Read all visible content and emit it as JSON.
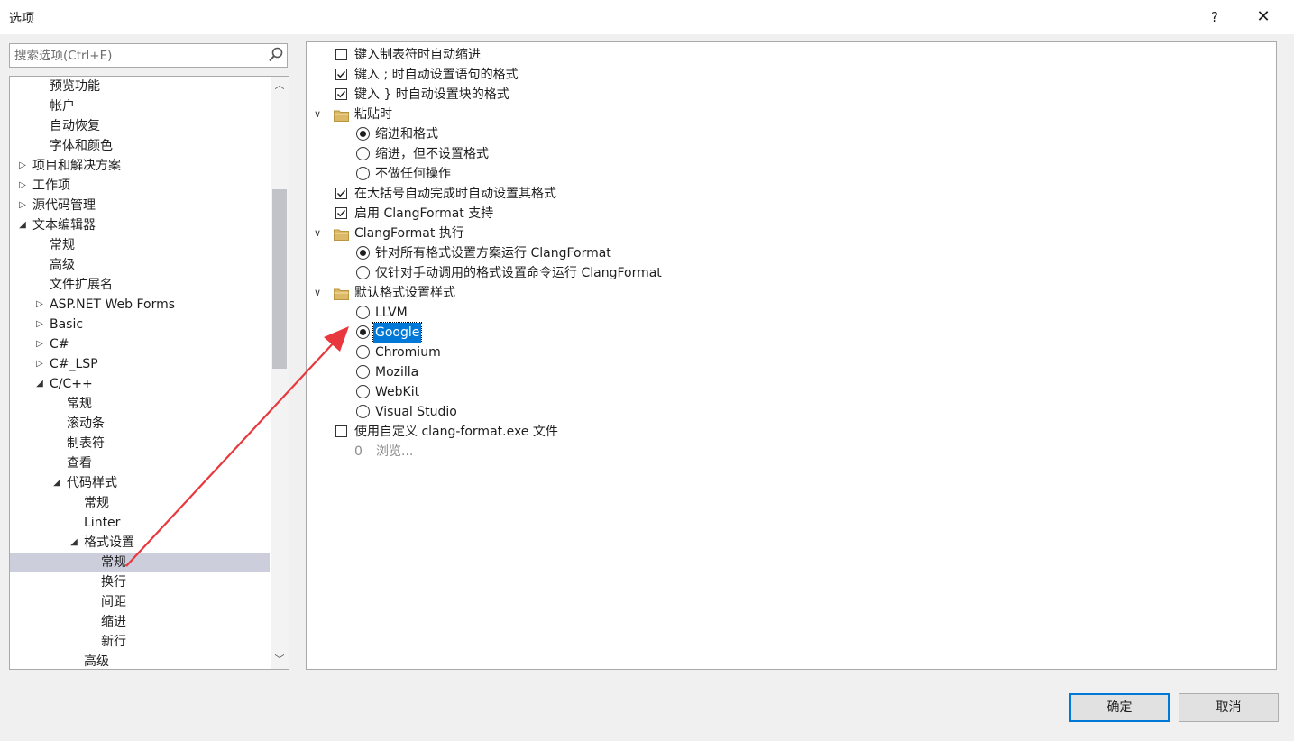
{
  "window": {
    "title": "选项",
    "help_label": "?",
    "close_label": "✕"
  },
  "search": {
    "placeholder": "搜索选项(Ctrl+E)",
    "value": ""
  },
  "tree": {
    "items": [
      {
        "label": "预览功能",
        "arrow": ""
      },
      {
        "label": "帐户",
        "arrow": ""
      },
      {
        "label": "自动恢复",
        "arrow": ""
      },
      {
        "label": "字体和颜色",
        "arrow": ""
      },
      {
        "label": "项目和解决方案",
        "arrow": "▷"
      },
      {
        "label": "工作项",
        "arrow": "▷"
      },
      {
        "label": "源代码管理",
        "arrow": "▷"
      },
      {
        "label": "文本编辑器",
        "arrow": "◢"
      },
      {
        "label": "常规",
        "arrow": ""
      },
      {
        "label": "高级",
        "arrow": ""
      },
      {
        "label": "文件扩展名",
        "arrow": ""
      },
      {
        "label": "ASP.NET Web Forms",
        "arrow": "▷"
      },
      {
        "label": "Basic",
        "arrow": "▷"
      },
      {
        "label": "C#",
        "arrow": "▷"
      },
      {
        "label": "C#_LSP",
        "arrow": "▷"
      },
      {
        "label": "C/C++",
        "arrow": "◢"
      },
      {
        "label": "常规",
        "arrow": ""
      },
      {
        "label": "滚动条",
        "arrow": ""
      },
      {
        "label": "制表符",
        "arrow": ""
      },
      {
        "label": "查看",
        "arrow": ""
      },
      {
        "label": "代码样式",
        "arrow": "◢"
      },
      {
        "label": "常规",
        "arrow": ""
      },
      {
        "label": "Linter",
        "arrow": ""
      },
      {
        "label": "格式设置",
        "arrow": "◢"
      },
      {
        "label": "常规",
        "arrow": "",
        "selected": true
      },
      {
        "label": "换行",
        "arrow": ""
      },
      {
        "label": "间距",
        "arrow": ""
      },
      {
        "label": "缩进",
        "arrow": ""
      },
      {
        "label": "新行",
        "arrow": ""
      },
      {
        "label": "高级",
        "arrow": ""
      }
    ]
  },
  "options": {
    "auto_indent_tab": {
      "label": "键入制表符时自动缩进",
      "checked": false
    },
    "format_on_semicolon": {
      "label": "键入 ; 时自动设置语句的格式",
      "checked": true
    },
    "format_on_brace": {
      "label": "键入 } 时自动设置块的格式",
      "checked": true
    },
    "paste_group": {
      "label": "粘贴时",
      "choices": [
        "缩进和格式",
        "缩进，但不设置格式",
        "不做任何操作"
      ],
      "selected": "缩进和格式"
    },
    "format_on_brace_complete": {
      "label": "在大括号自动完成时自动设置其格式",
      "checked": true
    },
    "enable_clangformat": {
      "label": "启用 ClangFormat 支持",
      "checked": true
    },
    "clangformat_exec_group": {
      "label": "ClangFormat 执行",
      "choices": [
        "针对所有格式设置方案运行 ClangFormat",
        "仅针对手动调用的格式设置命令运行 ClangFormat"
      ],
      "selected": "针对所有格式设置方案运行 ClangFormat"
    },
    "default_style_group": {
      "label": "默认格式设置样式",
      "choices": [
        "LLVM",
        "Google",
        "Chromium",
        "Mozilla",
        "WebKit",
        "Visual Studio"
      ],
      "selected": "Google"
    },
    "custom_clang_format": {
      "label": "使用自定义 clang-format.exe 文件",
      "checked": false
    },
    "browse": {
      "prefix": "0",
      "label": "浏览..."
    }
  },
  "buttons": {
    "ok": "确定",
    "cancel": "取消"
  },
  "colors": {
    "accent": "#0078d7",
    "tree_selected": "#cccedb",
    "annotation_arrow": "#e8383d",
    "folder": "#dcb967"
  }
}
